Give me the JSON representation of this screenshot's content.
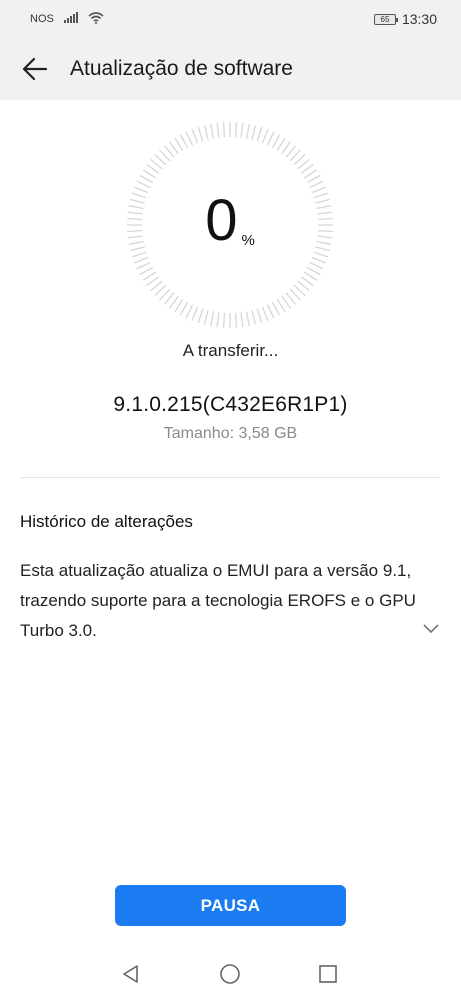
{
  "status_bar": {
    "carrier": "NOS",
    "battery_level": "65",
    "time": "13:30"
  },
  "header": {
    "title": "Atualização de software"
  },
  "progress": {
    "value": "0",
    "unit": "%",
    "status_text": "A transferir..."
  },
  "update": {
    "version": "9.1.0.215(C432E6R1P1)",
    "size_text": "Tamanho: 3,58 GB"
  },
  "changelog": {
    "title": "Histórico de alterações",
    "body": "Esta atualização atualiza o EMUI para a versão 9.1, trazendo suporte para a tecnologia EROFS e o GPU Turbo 3.0."
  },
  "actions": {
    "pause_label": "PAUSA"
  },
  "colors": {
    "accent": "#1a7cf0",
    "header_bg": "#f1f1f1",
    "secondary_text": "#8a8a8a"
  },
  "icons": {
    "back": "arrow-left-icon",
    "expand": "chevron-down-icon",
    "nav_back": "triangle-back-icon",
    "nav_home": "circle-home-icon",
    "nav_recents": "square-recents-icon"
  }
}
